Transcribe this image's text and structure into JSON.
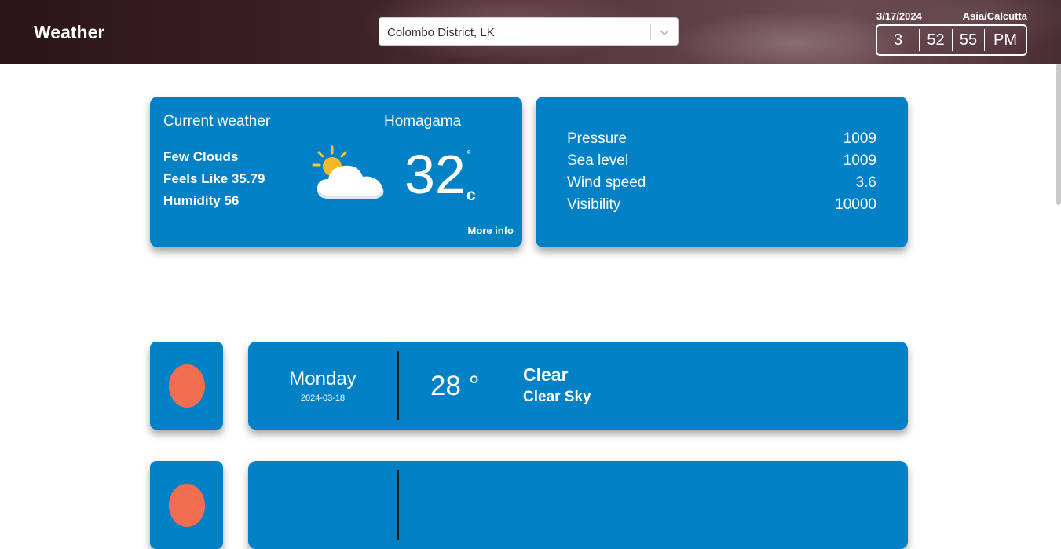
{
  "header": {
    "brand": "Weather",
    "location_select": {
      "value": "Colombo District, LK"
    },
    "clock": {
      "date": "3/17/2024",
      "timezone": "Asia/Calcutta",
      "hour": "3",
      "minute": "52",
      "second": "55",
      "period": "PM"
    }
  },
  "current": {
    "title": "Current weather",
    "city": "Homagama",
    "condition": "Few Clouds",
    "feels_like": "Feels Like 35.79",
    "humidity": "Humidity 56",
    "temperature": "32",
    "degree_symbol": "°",
    "unit": "c",
    "more_info": "More info",
    "icon": "partly-cloudy-icon"
  },
  "stats": [
    {
      "label": "Pressure",
      "value": "1009"
    },
    {
      "label": "Sea level",
      "value": "1009"
    },
    {
      "label": "Wind speed",
      "value": "3.6"
    },
    {
      "label": "Visibility",
      "value": "10000"
    }
  ],
  "forecast": [
    {
      "day": "Monday",
      "date": "2024-03-18",
      "temp": "28 °",
      "main": "Clear",
      "description": "Clear Sky",
      "icon": "sun-dot-icon"
    },
    {
      "icon": "sun-dot-icon"
    }
  ],
  "colors": {
    "card": "#0381c6",
    "sun_dot": "#ef6f50",
    "header_dark": "#2b1518"
  }
}
